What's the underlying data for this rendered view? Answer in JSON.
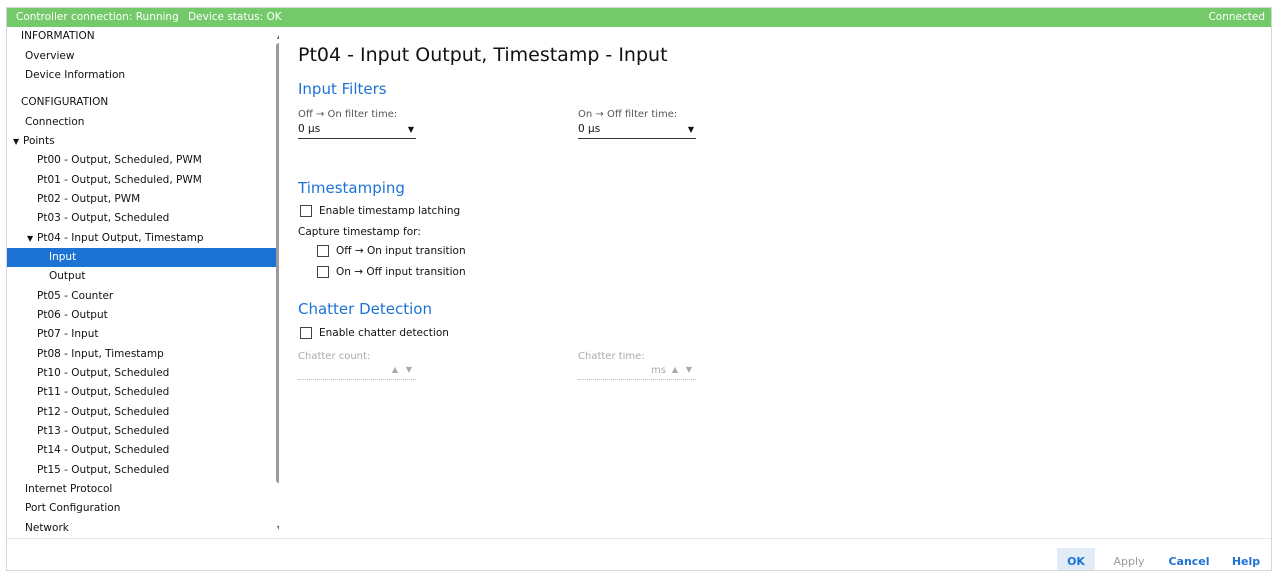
{
  "status": {
    "controller_connection": "Controller connection: Running",
    "device_status": "Device status: OK",
    "connection_state": "Connected"
  },
  "sidebar": {
    "items": [
      {
        "label": "INFORMATION"
      },
      {
        "label": "Overview"
      },
      {
        "label": "Device Information"
      },
      {
        "label": "CONFIGURATION"
      },
      {
        "label": "Connection"
      },
      {
        "label": "Points"
      },
      {
        "label": "Pt00 - Output, Scheduled, PWM"
      },
      {
        "label": "Pt01 - Output, Scheduled, PWM"
      },
      {
        "label": "Pt02 - Output, PWM"
      },
      {
        "label": "Pt03 - Output, Scheduled"
      },
      {
        "label": "Pt04 - Input Output, Timestamp"
      },
      {
        "label": "Input"
      },
      {
        "label": "Output"
      },
      {
        "label": "Pt05 - Counter"
      },
      {
        "label": "Pt06 - Output"
      },
      {
        "label": "Pt07 - Input"
      },
      {
        "label": "Pt08 - Input, Timestamp"
      },
      {
        "label": "Pt10 - Output, Scheduled"
      },
      {
        "label": "Pt11 - Output, Scheduled"
      },
      {
        "label": "Pt12 - Output, Scheduled"
      },
      {
        "label": "Pt13 - Output, Scheduled"
      },
      {
        "label": "Pt14 - Output, Scheduled"
      },
      {
        "label": "Pt15 - Output, Scheduled"
      },
      {
        "label": "Internet Protocol"
      },
      {
        "label": "Port Configuration"
      },
      {
        "label": "Network"
      }
    ],
    "selected_label": "Input"
  },
  "main": {
    "title": "Pt04 - Input Output, Timestamp - Input",
    "input_filters": {
      "heading": "Input Filters",
      "off_on_label": "Off → On filter time:",
      "off_on_value": "0 µs",
      "on_off_label": "On → Off filter time:",
      "on_off_value": "0 µs"
    },
    "timestamping": {
      "heading": "Timestamping",
      "enable_latching_label": "Enable timestamp latching",
      "enable_latching_checked": false,
      "capture_label": "Capture timestamp for:",
      "off_on_transition_label": "Off → On input transition",
      "off_on_transition_checked": false,
      "on_off_transition_label": "On → Off input transition",
      "on_off_transition_checked": false
    },
    "chatter": {
      "heading": "Chatter Detection",
      "enable_label": "Enable chatter detection",
      "enable_checked": false,
      "count_label": "Chatter count:",
      "time_label": "Chatter time:",
      "time_unit": "ms"
    }
  },
  "buttons": {
    "ok": "OK",
    "apply": "Apply",
    "cancel": "Cancel",
    "help": "Help"
  },
  "icons": {
    "expanded_caret": "caret-down-icon",
    "dropdown_arrow": "chevron-down-icon",
    "spin_up": "spin-up-icon",
    "spin_down": "spin-down-icon",
    "scroll_up": "scroll-up-icon",
    "scroll_down": "scroll-down-icon"
  },
  "colors": {
    "status_bar": "#74c96a",
    "accent": "#1c73d4",
    "selected_item": "#1c73d4"
  }
}
